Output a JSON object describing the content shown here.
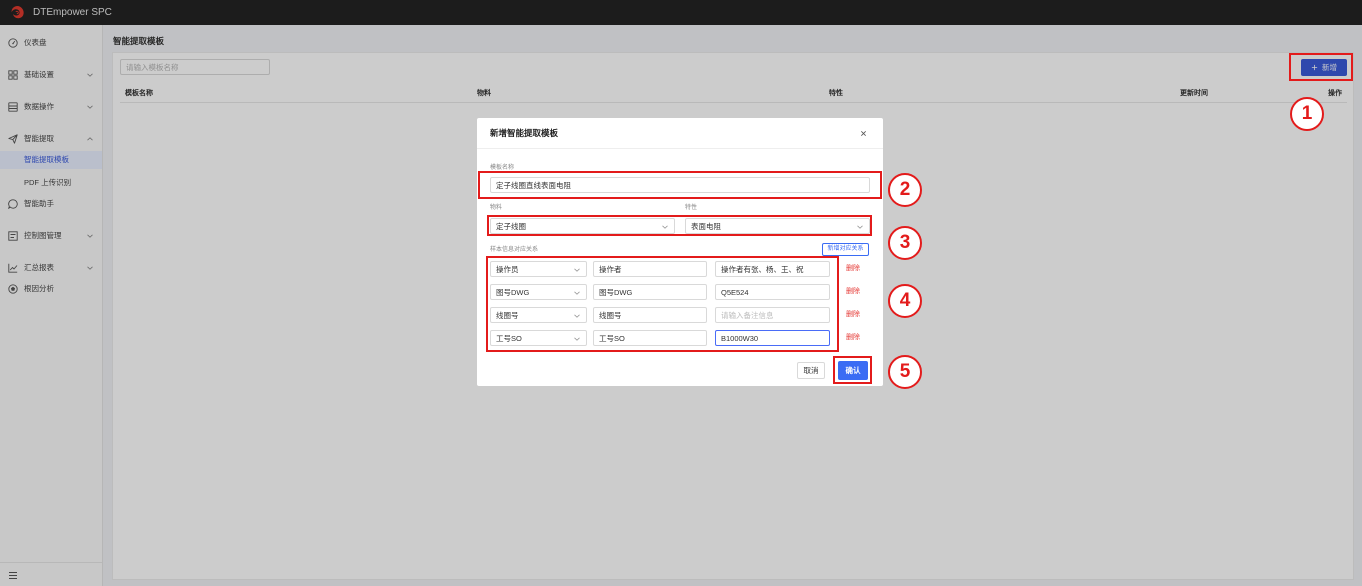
{
  "app": {
    "title": "DTEmpower SPC",
    "logo_icon": "swirl-logo-icon"
  },
  "sidebar": {
    "items": [
      {
        "label": "仪表盘",
        "icon": "dashboard-icon"
      },
      {
        "label": "基础设置",
        "icon": "grid-icon",
        "toggle_icon": "chevron-down-icon"
      },
      {
        "label": "数据操作",
        "icon": "data-icon",
        "toggle_icon": "chevron-down-icon"
      },
      {
        "label": "智能提取",
        "icon": "send-icon",
        "toggle_icon": "chevron-up-icon",
        "expanded": true
      },
      {
        "label": "智能提取模板",
        "active": true
      },
      {
        "label": "PDF 上传识别"
      },
      {
        "label": "智能助手",
        "icon": "chat-icon"
      },
      {
        "label": "控制图管理",
        "icon": "control-chart-icon",
        "toggle_icon": "chevron-down-icon"
      },
      {
        "label": "汇总报表",
        "icon": "line-chart-icon",
        "toggle_icon": "chevron-down-icon"
      },
      {
        "label": "根因分析",
        "icon": "root-cause-icon"
      }
    ],
    "footer_icon": "menu-icon"
  },
  "main": {
    "page_title": "智能提取模板",
    "search": {
      "placeholder": "请输入模板名称"
    },
    "add_button": {
      "icon": "plus-icon",
      "label": "新增"
    },
    "table": {
      "columns": [
        "模板名称",
        "物料",
        "特性",
        "更新时间",
        "操作"
      ],
      "rows": []
    }
  },
  "modal": {
    "title": "新增智能提取模板",
    "close_icon": "close-icon",
    "template_name": {
      "label": "模板名称",
      "value": "定子线圈直线表面电阻"
    },
    "material": {
      "label": "物料",
      "value": "定子线圈"
    },
    "characteristic": {
      "label": "特性",
      "value": "表面电阻"
    },
    "sample_mapping": {
      "label": "样本信息对应关系",
      "add_label": "新增对应关系",
      "rows": [
        {
          "field": "操作员",
          "name": "操作者",
          "note": "操作者有张、杨、王、祝",
          "delete_label": "删除"
        },
        {
          "field": "图号DWG",
          "name": "图号DWG",
          "note": "Q5E524",
          "delete_label": "删除"
        },
        {
          "field": "线圈号",
          "name": "线圈号",
          "note_placeholder": "请输入备注信息",
          "delete_label": "删除"
        },
        {
          "field": "工号SO",
          "name": "工号SO",
          "note": "B1000W30",
          "delete_label": "删除",
          "focused": true
        }
      ]
    },
    "cancel_label": "取消",
    "confirm_label": "确认"
  },
  "annotations": {
    "markers": [
      "1",
      "2",
      "3",
      "4",
      "5"
    ]
  },
  "colors": {
    "accent": "#3a5bd9",
    "primary_button": "#3a6cf4",
    "danger": "#e53935",
    "annotation": "#e31b1b",
    "topbar": "#232323"
  }
}
